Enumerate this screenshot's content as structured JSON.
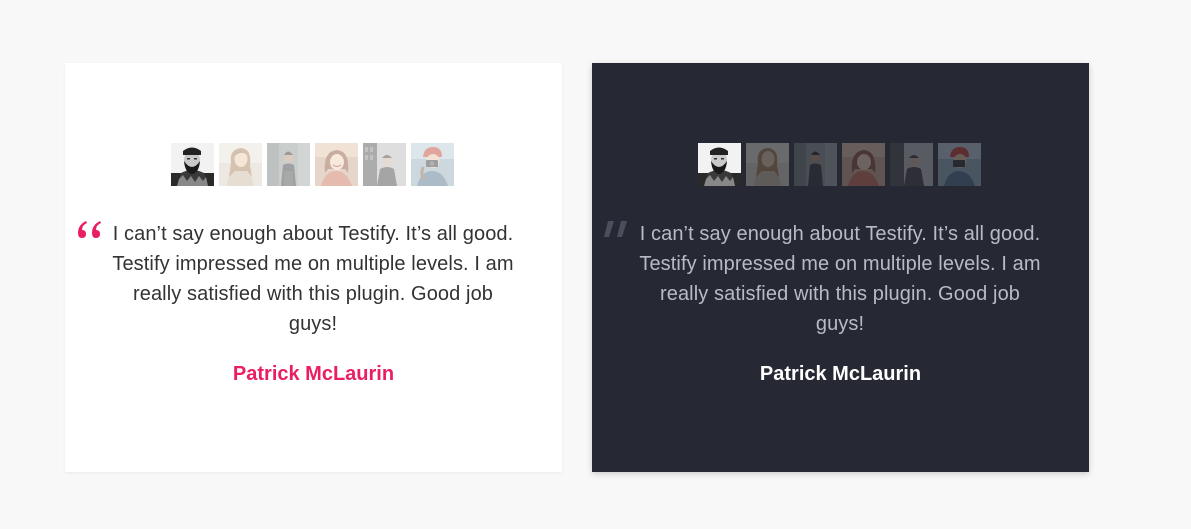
{
  "colors": {
    "page_background": "#f8f8f8",
    "light_card_background": "#ffffff",
    "dark_card_background": "#262934",
    "accent": "#e91e63",
    "dark_quote_mark": "#4b4f5c",
    "dark_text": "#b9bbc2"
  },
  "light_card": {
    "thumbnails": [
      {
        "icon": "bearded-man-avatar",
        "active": true
      },
      {
        "icon": "woman-avatar",
        "active": false
      },
      {
        "icon": "man-standing-avatar",
        "active": false
      },
      {
        "icon": "woman-smiling-avatar",
        "active": false
      },
      {
        "icon": "man-city-avatar",
        "active": false
      },
      {
        "icon": "woman-camera-avatar",
        "active": false
      }
    ],
    "quote_icon": "open-quote-icon",
    "quote": "I can’t say enough about Testify. It’s all good. Testify impressed me on multiple levels. I am really satisfied with this plugin. Good job guys!",
    "author": "Patrick McLaurin"
  },
  "dark_card": {
    "thumbnails": [
      {
        "icon": "bearded-man-avatar",
        "active": true
      },
      {
        "icon": "woman-avatar",
        "active": false
      },
      {
        "icon": "man-standing-avatar",
        "active": false
      },
      {
        "icon": "woman-smiling-avatar",
        "active": false
      },
      {
        "icon": "man-city-avatar",
        "active": false
      },
      {
        "icon": "woman-camera-avatar",
        "active": false
      }
    ],
    "quote_icon": "open-quote-icon",
    "quote": "I can’t say enough about Testify. It’s all good. Testify impressed me on multiple levels. I am really satisfied with this plugin. Good job guys!",
    "author": "Patrick McLaurin"
  }
}
